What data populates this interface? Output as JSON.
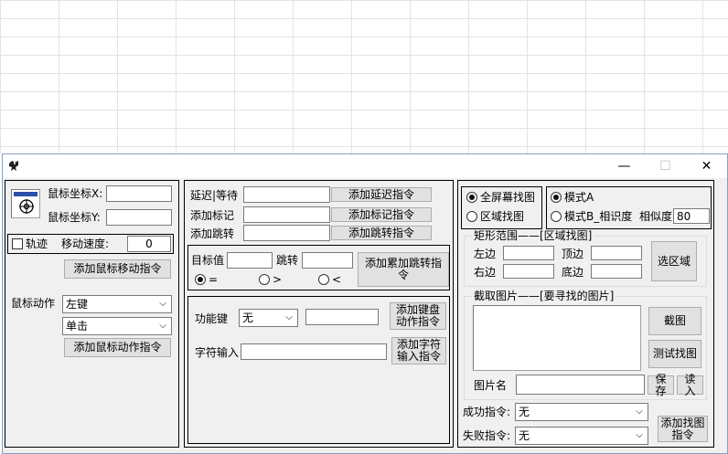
{
  "mouse": {
    "coord_x_label": "鼠标坐标X:",
    "coord_y_label": "鼠标坐标Y:",
    "coord_x_value": "",
    "coord_y_value": "",
    "trail_label": "轨迹",
    "speed_label": "移动速度:",
    "speed_value": "0",
    "add_move_btn": "添加鼠标移动指令",
    "action_label": "鼠标动作",
    "button_select": "左键",
    "click_select": "单击",
    "add_action_btn": "添加鼠标动作指令"
  },
  "middle": {
    "delay_label": "延迟|等待",
    "add_delay_btn": "添加延迟指令",
    "mark_label": "添加标记",
    "add_mark_btn": "添加标记指令",
    "jump_label": "添加跳转",
    "add_jump_btn": "添加跳转指令",
    "target_label": "目标值",
    "jump2_label": "跳转",
    "add_acc_jump_btn": "添加累加跳转指令",
    "radio_eq": "=",
    "radio_gt": ">",
    "radio_lt": "<",
    "funckey_label": "功能键",
    "funckey_select": "无",
    "add_key_btn": "添加键盘动作指令",
    "text_input_label": "字符输入",
    "add_text_btn": "添加字符输入指令"
  },
  "right": {
    "fullscreen_find": "全屏幕找图",
    "region_find": "区域找图",
    "mode_a": "模式A",
    "mode_b": "模式B_相识度",
    "similarity_label": "相似度",
    "similarity_value": "80",
    "rect_title": "矩形范围——[区域找图]",
    "left_label": "左边",
    "top_label": "顶边",
    "right_label": "右边",
    "bottom_label": "底边",
    "select_region_btn": "选区域",
    "capture_title": "截取图片——[要寻找的图片]",
    "capture_btn": "截图",
    "test_find_btn": "测试找图",
    "image_name_label": "图片名",
    "save_btn": "保存",
    "read_btn": "读入",
    "success_label": "成功指令:",
    "success_select": "无",
    "fail_label": "失败指令:",
    "fail_select": "无",
    "add_find_btn": "添加找图指令"
  },
  "titlebar": {
    "minimize": "—",
    "maximize": "☐",
    "close": "✕"
  }
}
